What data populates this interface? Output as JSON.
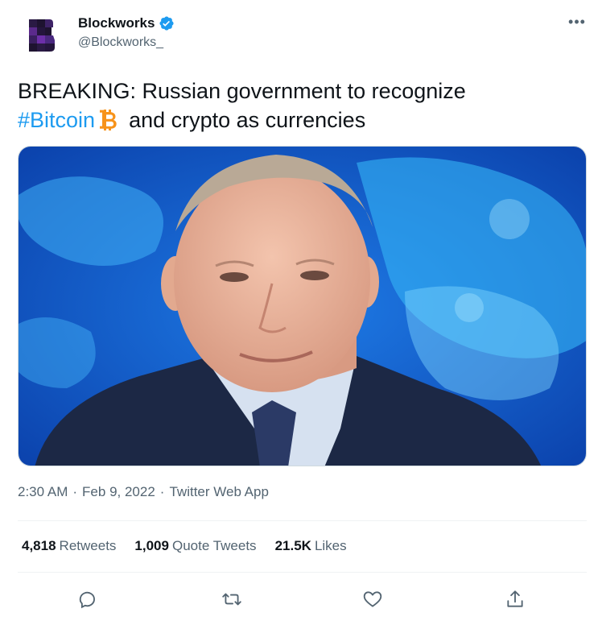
{
  "author": {
    "name": "Blockworks",
    "handle": "@Blockworks_",
    "verified": true,
    "avatar_icon": "blockworks-logo",
    "avatar_color": "#1b1230"
  },
  "more_icon": "more-horizontal-icon",
  "more_label": "•••",
  "tweet": {
    "text_main": "BREAKING: Russian government to recognize",
    "hashtag": "#Bitcoin",
    "emoji": "bitcoin-emoji",
    "text_tail": "and crypto as currencies"
  },
  "media": {
    "description_icon": "tweet-photo"
  },
  "meta": {
    "time": "2:30 AM",
    "separator": "·",
    "date": "Feb 9, 2022",
    "source": "Twitter Web App"
  },
  "stats": {
    "retweets_count": "4,818",
    "retweets_label": "Retweets",
    "quotes_count": "1,009",
    "quotes_label": "Quote Tweets",
    "likes_count": "21.5K",
    "likes_label": "Likes"
  },
  "colors": {
    "link": "#1d9bf0",
    "secondary_text": "#536471",
    "verified": "#1d9bf0",
    "bitcoin": "#f7931a"
  }
}
